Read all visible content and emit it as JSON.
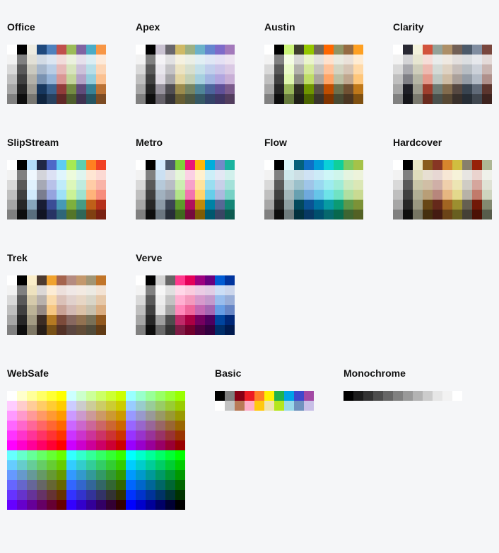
{
  "palettes": [
    {
      "name": "Office",
      "type": "theme",
      "base": [
        "#FFFFFF",
        "#000000",
        "#EEECE1",
        "#1F497D",
        "#4F81BD",
        "#C0504D",
        "#9BBB59",
        "#8064A2",
        "#4BACC6",
        "#F79646"
      ]
    },
    {
      "name": "Apex",
      "type": "theme",
      "base": [
        "#FFFFFF",
        "#000000",
        "#C9C2D1",
        "#69676D",
        "#CEB966",
        "#9CB084",
        "#6BB1C9",
        "#6585CF",
        "#7E6BC9",
        "#A379BB"
      ]
    },
    {
      "name": "Austin",
      "type": "theme",
      "base": [
        "#FFFFFF",
        "#000000",
        "#CAF278",
        "#3E3D2D",
        "#94C600",
        "#71685A",
        "#FF6700",
        "#909465",
        "#956B43",
        "#FEA022"
      ]
    },
    {
      "name": "Clarity",
      "type": "theme",
      "base": [
        "#FFFFFF",
        "#292934",
        "#F3F2DC",
        "#D2533C",
        "#93A299",
        "#AD8F67",
        "#726056",
        "#4C5A6A",
        "#808DA0",
        "#79463D"
      ]
    },
    {
      "name": "SlipStream",
      "type": "theme",
      "base": [
        "#FFFFFF",
        "#000000",
        "#B4DCFA",
        "#212745",
        "#4E67C8",
        "#5ECCF3",
        "#A7EA52",
        "#5DCEAF",
        "#FF8021",
        "#F14124"
      ]
    },
    {
      "name": "Metro",
      "type": "theme",
      "base": [
        "#FFFFFF",
        "#000000",
        "#D6ECFF",
        "#4E5B6F",
        "#7FD13B",
        "#EA157A",
        "#FEB80A",
        "#00ADDC",
        "#738AC8",
        "#1AB39F"
      ]
    },
    {
      "name": "Flow",
      "type": "theme",
      "base": [
        "#FFFFFF",
        "#000000",
        "#DBF5F9",
        "#04617B",
        "#0F6FC6",
        "#009DD9",
        "#0BD0D9",
        "#10CF9B",
        "#7CCA62",
        "#A5C249"
      ]
    },
    {
      "name": "Hardcover",
      "type": "theme",
      "base": [
        "#FFFFFF",
        "#000000",
        "#ECE9C6",
        "#895D1D",
        "#873624",
        "#D6862D",
        "#D0BE40",
        "#877F6C",
        "#972109",
        "#AEB795"
      ]
    },
    {
      "name": "Trek",
      "type": "theme",
      "base": [
        "#FFFFFF",
        "#000000",
        "#FBEEC9",
        "#4E3B30",
        "#F0A22E",
        "#A5644E",
        "#B58B80",
        "#C3986D",
        "#A19574",
        "#C17529"
      ]
    },
    {
      "name": "Verve",
      "type": "theme",
      "base": [
        "#FFFFFF",
        "#000000",
        "#D2D2D2",
        "#666666",
        "#FF388C",
        "#E40059",
        "#9C007F",
        "#68007F",
        "#005BD3",
        "#00349E"
      ]
    },
    {
      "name": "WebSafe",
      "type": "websafe"
    },
    {
      "name": "Basic",
      "type": "flat",
      "cols": 10,
      "colors": [
        "#000000",
        "#7F7F7F",
        "#880015",
        "#ED1C24",
        "#FF7F27",
        "#FFF200",
        "#22B14C",
        "#00A2E8",
        "#3F48CC",
        "#A349A4",
        "#FFFFFF",
        "#C3C3C3",
        "#B97A57",
        "#FFAEC9",
        "#FFC90E",
        "#EFE4B0",
        "#B5E61D",
        "#99D9EA",
        "#7092BE",
        "#C8BFE7"
      ]
    },
    {
      "name": "Monochrome",
      "type": "flat",
      "cols": 12,
      "colors": [
        "#000000",
        "#1C1C1C",
        "#333333",
        "#4D4D4D",
        "#666666",
        "#808080",
        "#999999",
        "#B3B3B3",
        "#CCCCCC",
        "#E6E6E6",
        "#F2F2F2",
        "#FFFFFF"
      ]
    }
  ]
}
